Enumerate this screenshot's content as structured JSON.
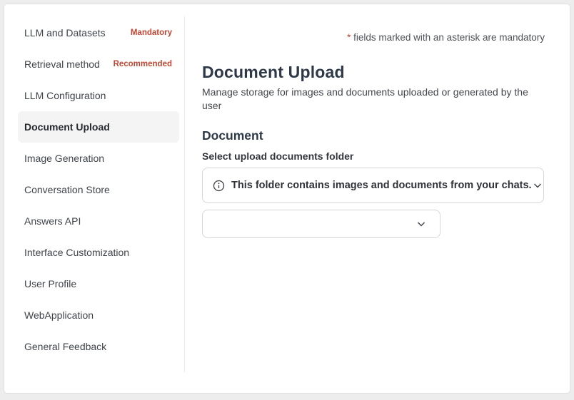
{
  "colors": {
    "page_background": "#ededed",
    "card_background": "#ffffff",
    "accent_red": "#bf4633",
    "heading_text": "#2e3947",
    "active_item_background": "#f4f4f4",
    "control_border": "#d6d6d6"
  },
  "sidebar": {
    "items": [
      {
        "label": "LLM and Datasets",
        "badge": "Mandatory",
        "active": false
      },
      {
        "label": "Retrieval method",
        "badge": "Recommended",
        "active": false
      },
      {
        "label": "LLM Configuration",
        "active": false
      },
      {
        "label": "Document Upload",
        "active": true
      },
      {
        "label": "Image Generation",
        "active": false
      },
      {
        "label": "Conversation Store",
        "active": false
      },
      {
        "label": "Answers API",
        "active": false
      },
      {
        "label": "Interface Customization",
        "active": false
      },
      {
        "label": "User Profile",
        "active": false
      },
      {
        "label": "WebApplication",
        "active": false
      },
      {
        "label": "General Feedback",
        "active": false
      }
    ]
  },
  "main": {
    "mandatory_note": {
      "asterisk": "*",
      "text": " fields marked with an asterisk are mandatory"
    },
    "title": "Document Upload",
    "subtitle": "Manage storage for images and documents uploaded or generated by the user",
    "document_section": {
      "heading": "Document",
      "field_label": "Select upload documents folder",
      "folder_select": {
        "info_icon": "info-icon",
        "value": "This folder contains images and documents from your chats.",
        "chevron_icon": "chevron-down-icon"
      },
      "secondary_select": {
        "value": "",
        "chevron_icon": "chevron-down-icon"
      }
    }
  }
}
